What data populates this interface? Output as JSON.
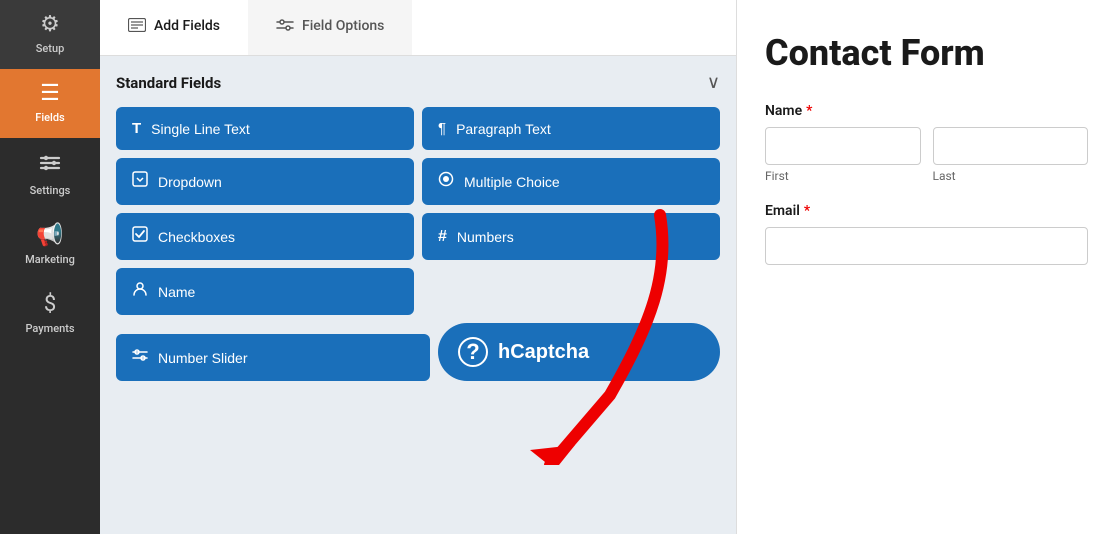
{
  "sidebar": {
    "items": [
      {
        "id": "setup",
        "label": "Setup",
        "icon": "⚙",
        "active": false
      },
      {
        "id": "fields",
        "label": "Fields",
        "icon": "☰",
        "active": true
      },
      {
        "id": "settings",
        "label": "Settings",
        "icon": "⚡",
        "active": false
      },
      {
        "id": "marketing",
        "label": "Marketing",
        "icon": "📢",
        "active": false
      },
      {
        "id": "payments",
        "label": "Payments",
        "icon": "$",
        "active": false
      }
    ]
  },
  "tabs": [
    {
      "id": "add-fields",
      "label": "Add Fields",
      "icon": "▦",
      "active": true
    },
    {
      "id": "field-options",
      "label": "Field Options",
      "icon": "⇌",
      "active": false
    }
  ],
  "fields_section": {
    "title": "Standard Fields",
    "fields": [
      {
        "id": "single-line-text",
        "label": "Single Line Text",
        "icon": "T"
      },
      {
        "id": "paragraph-text",
        "label": "Paragraph Text",
        "icon": "¶"
      },
      {
        "id": "dropdown",
        "label": "Dropdown",
        "icon": "⊡"
      },
      {
        "id": "multiple-choice",
        "label": "Multiple Choice",
        "icon": "◎"
      },
      {
        "id": "checkboxes",
        "label": "Checkboxes",
        "icon": "☑"
      },
      {
        "id": "numbers",
        "label": "Numbers",
        "icon": "#"
      },
      {
        "id": "name",
        "label": "Name",
        "icon": "👤"
      }
    ],
    "bottom_fields": [
      {
        "id": "number-slider",
        "label": "Number Slider",
        "icon": "⚌"
      }
    ],
    "hcaptcha": {
      "label": "hCaptcha",
      "icon": "?"
    }
  },
  "form_preview": {
    "title": "Contact Form",
    "fields": [
      {
        "id": "name",
        "label": "Name",
        "required": true,
        "type": "name",
        "sub_fields": [
          {
            "placeholder": "",
            "sub_label": "First"
          },
          {
            "placeholder": "",
            "sub_label": "Last"
          }
        ]
      },
      {
        "id": "email",
        "label": "Email",
        "required": true,
        "type": "email",
        "placeholder": ""
      }
    ]
  }
}
